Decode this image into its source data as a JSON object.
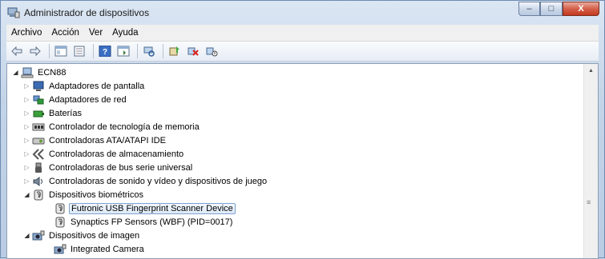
{
  "window": {
    "title": "Administrador de dispositivos",
    "minimize": "–",
    "maximize": "□",
    "close": "X"
  },
  "menu": [
    "Archivo",
    "Acción",
    "Ver",
    "Ayuda"
  ],
  "tree": {
    "root": "ECN88",
    "categories": [
      {
        "label": "Adaptadores de pantalla",
        "icon": "display-adapter-icon",
        "expanded": false
      },
      {
        "label": "Adaptadores de red",
        "icon": "network-adapter-icon",
        "expanded": false
      },
      {
        "label": "Baterías",
        "icon": "battery-icon",
        "expanded": false
      },
      {
        "label": "Controlador de tecnología de memoria",
        "icon": "memory-controller-icon",
        "expanded": false
      },
      {
        "label": "Controladoras ATA/ATAPI IDE",
        "icon": "ide-controller-icon",
        "expanded": false
      },
      {
        "label": "Controladoras de almacenamiento",
        "icon": "storage-controller-icon",
        "expanded": false
      },
      {
        "label": "Controladoras de bus serie universal",
        "icon": "usb-icon",
        "expanded": false
      },
      {
        "label": "Controladoras de sonido y vídeo y dispositivos de juego",
        "icon": "sound-icon",
        "expanded": false
      },
      {
        "label": "Dispositivos biométricos",
        "icon": "biometric-icon",
        "expanded": true,
        "children": [
          "Futronic USB Fingerprint Scanner Device",
          "Synaptics FP Sensors (WBF) (PID=0017)"
        ]
      },
      {
        "label": "Dispositivos de imagen",
        "icon": "imaging-device-icon",
        "expanded": true,
        "children": [
          "Integrated Camera"
        ]
      }
    ]
  },
  "selected_item": "Futronic USB Fingerprint Scanner Device",
  "colors": {
    "selection_border": "#7da2ce",
    "frame": "#c3d4e8"
  }
}
